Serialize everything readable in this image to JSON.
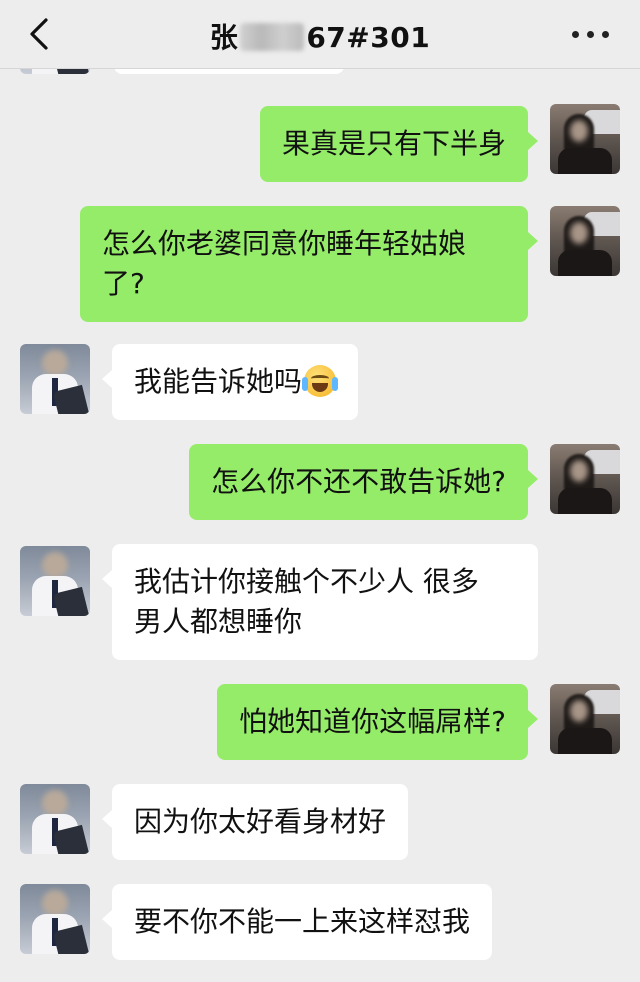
{
  "header": {
    "title_prefix": "张",
    "title_suffix": "67#301",
    "back_icon": "chevron-left-icon",
    "more_icon": "more-dots-icon"
  },
  "messages": [
    {
      "side": "out",
      "text": "果真是只有下半身"
    },
    {
      "side": "out",
      "text": "怎么你老婆同意你睡年轻姑娘",
      "text2": "了?"
    },
    {
      "side": "in",
      "text": "我能告诉她吗",
      "emoji": "crying-laughing-emoji"
    },
    {
      "side": "out",
      "text": "怎么你不还不敢告诉她?"
    },
    {
      "side": "in",
      "text": "我估计你接触个不少人 很多",
      "text2": "男人都想睡你"
    },
    {
      "side": "out",
      "text": "怕她知道你这幅屌样?"
    },
    {
      "side": "in",
      "text": "因为你太好看身材好"
    },
    {
      "side": "in",
      "text": "要不你不能一上来这样怼我"
    }
  ],
  "colors": {
    "background": "#ededed",
    "outgoing_bubble": "#95ec69",
    "incoming_bubble": "#ffffff"
  }
}
